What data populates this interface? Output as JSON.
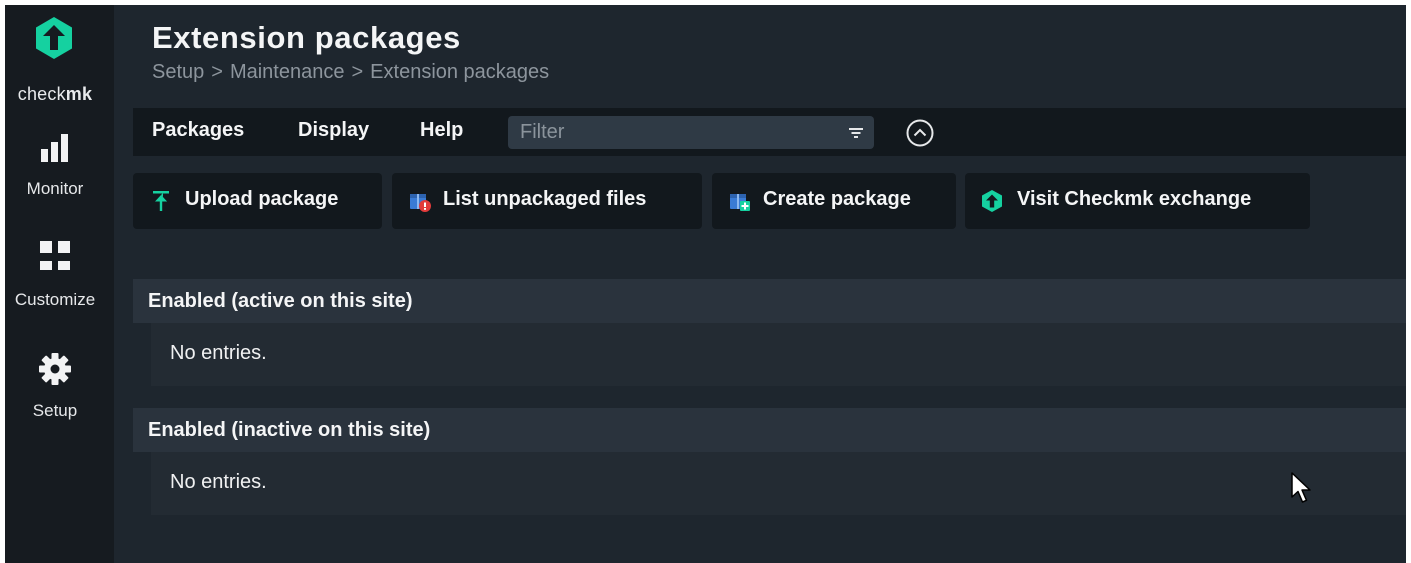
{
  "sidebar": {
    "logo": {
      "prefix": "check",
      "suffix": "mk",
      "icon": "checkmk-logo-icon"
    },
    "items": [
      {
        "label": "Monitor",
        "icon": "bar-chart-icon"
      },
      {
        "label": "Customize",
        "icon": "grid-icon"
      },
      {
        "label": "Setup",
        "icon": "gear-icon"
      }
    ]
  },
  "header": {
    "title": "Extension packages",
    "breadcrumb": [
      "Setup",
      "Maintenance",
      "Extension packages"
    ],
    "breadcrumb_separator": ">"
  },
  "menubar": {
    "items": [
      "Packages",
      "Display",
      "Help"
    ],
    "filter_placeholder": "Filter",
    "filter_value": "",
    "filter_icon": "filter-lines-icon",
    "collapse_icon": "chevron-up-circle-icon"
  },
  "actions": [
    {
      "label": "Upload package",
      "icon": "upload-arrow-icon"
    },
    {
      "label": "List unpackaged files",
      "icon": "package-warning-icon"
    },
    {
      "label": "Create package",
      "icon": "package-add-icon"
    },
    {
      "label": "Visit Checkmk exchange",
      "icon": "checkmk-exchange-icon"
    }
  ],
  "sections": [
    {
      "title": "Enabled (active on this site)",
      "empty_text": "No entries."
    },
    {
      "title": "Enabled (inactive on this site)",
      "empty_text": "No entries."
    }
  ],
  "colors": {
    "background": "#1e262e",
    "sidebar": "#161b20",
    "menubar": "#12181d",
    "accent_green": "#15d1a0",
    "package_blue": "#3a7bd5",
    "warning_red": "#e23b3b"
  }
}
